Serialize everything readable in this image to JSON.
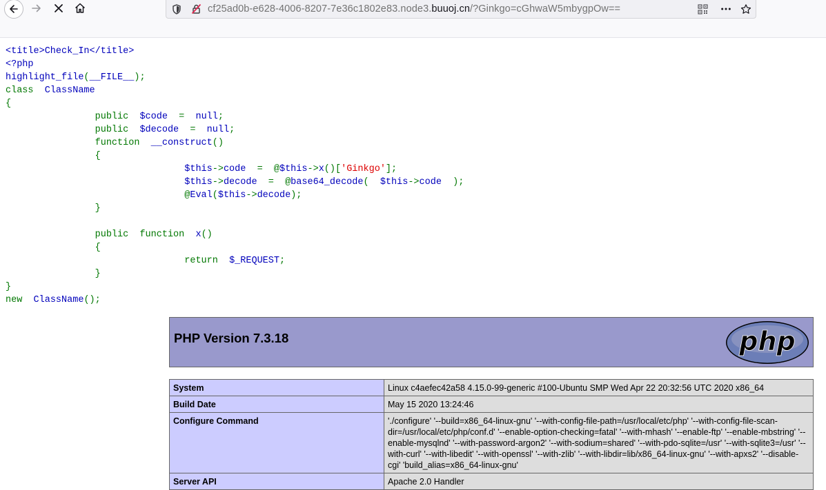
{
  "browser": {
    "url": {
      "prefix": "cf25ad0b-e628-4006-8207-7e36c1802e83.node3.",
      "host": "buuoj.cn",
      "suffix": "/?Ginkgo=cGhwaW5mbygpOw=="
    },
    "icons": {
      "back": "back-arrow-icon",
      "forward": "forward-arrow-icon",
      "stop": "stop-icon",
      "home": "home-icon",
      "shield": "shield-icon",
      "insecure": "insecure-lock-icon",
      "qr": "qr-code-icon",
      "more": "more-dots-icon",
      "bookmark": "bookmark-star-icon"
    }
  },
  "source_code": {
    "line1": "<title>Check_In</title>",
    "line2": "<?php",
    "line3_fn": "highlight_file",
    "line3_p1": "(",
    "line3_arg": "__FILE__",
    "line3_p2": ");",
    "line4_kw": "class  ",
    "line4_name": "ClassName",
    "line5": "{",
    "line6_kw": "                public  ",
    "line6_var": "$code  ",
    "line6_eq": "=  ",
    "line6_val": "null",
    "line6_semi": ";",
    "line7_kw": "                public  ",
    "line7_var": "$decode  ",
    "line7_eq": "=  ",
    "line7_val": "null",
    "line7_semi": ";",
    "line8_kw": "                function  ",
    "line8_name": "__construct",
    "line8_p": "()",
    "line9": "                {",
    "line10_a": "                                $this",
    "line10_b": "->",
    "line10_c": "code  ",
    "line10_d": "=  @",
    "line10_e": "$this",
    "line10_f": "->",
    "line10_g": "x",
    "line10_h": "()[",
    "line10_i": "'Ginkgo'",
    "line10_j": "];",
    "line11_a": "                                $this",
    "line11_b": "->",
    "line11_c": "decode  ",
    "line11_d": "=  @",
    "line11_e": "base64_decode",
    "line11_f": "(  ",
    "line11_g": "$this",
    "line11_h": "->",
    "line11_i": "code  ",
    "line11_j": ");",
    "line12_a": "                                @",
    "line12_b": "Eval",
    "line12_c": "(",
    "line12_d": "$this",
    "line12_e": "->",
    "line12_f": "decode",
    "line12_g": ");",
    "line13": "                }",
    "line14": "",
    "line15_kw": "                public  function  ",
    "line15_name": "x",
    "line15_p": "()",
    "line16": "                {",
    "line17_kw": "                                return  ",
    "line17_var": "$_REQUEST",
    "line17_semi": ";",
    "line18": "                }",
    "line19": "}",
    "line20_kw": "new  ",
    "line20_name": "ClassName",
    "line20_p": "();"
  },
  "phpinfo": {
    "title": "PHP Version 7.3.18",
    "logo_text": "php",
    "rows": [
      {
        "label": "System",
        "value": "Linux c4aefec42a58 4.15.0-99-generic #100-Ubuntu SMP Wed Apr 22 20:32:56 UTC 2020 x86_64"
      },
      {
        "label": "Build Date",
        "value": "May 15 2020 13:24:46"
      },
      {
        "label": "Configure Command",
        "value": "'./configure' '--build=x86_64-linux-gnu' '--with-config-file-path=/usr/local/etc/php' '--with-config-file-scan-dir=/usr/local/etc/php/conf.d' '--enable-option-checking=fatal' '--with-mhash' '--enable-ftp' '--enable-mbstring' '--enable-mysqlnd' '--with-password-argon2' '--with-sodium=shared' '--with-pdo-sqlite=/usr' '--with-sqlite3=/usr' '--with-curl' '--with-libedit' '--with-openssl' '--with-zlib' '--with-libdir=lib/x86_64-linux-gnu' '--with-apxs2' '--disable-cgi' 'build_alias=x86_64-linux-gnu'"
      },
      {
        "label": "Server API",
        "value": "Apache 2.0 Handler"
      }
    ]
  }
}
